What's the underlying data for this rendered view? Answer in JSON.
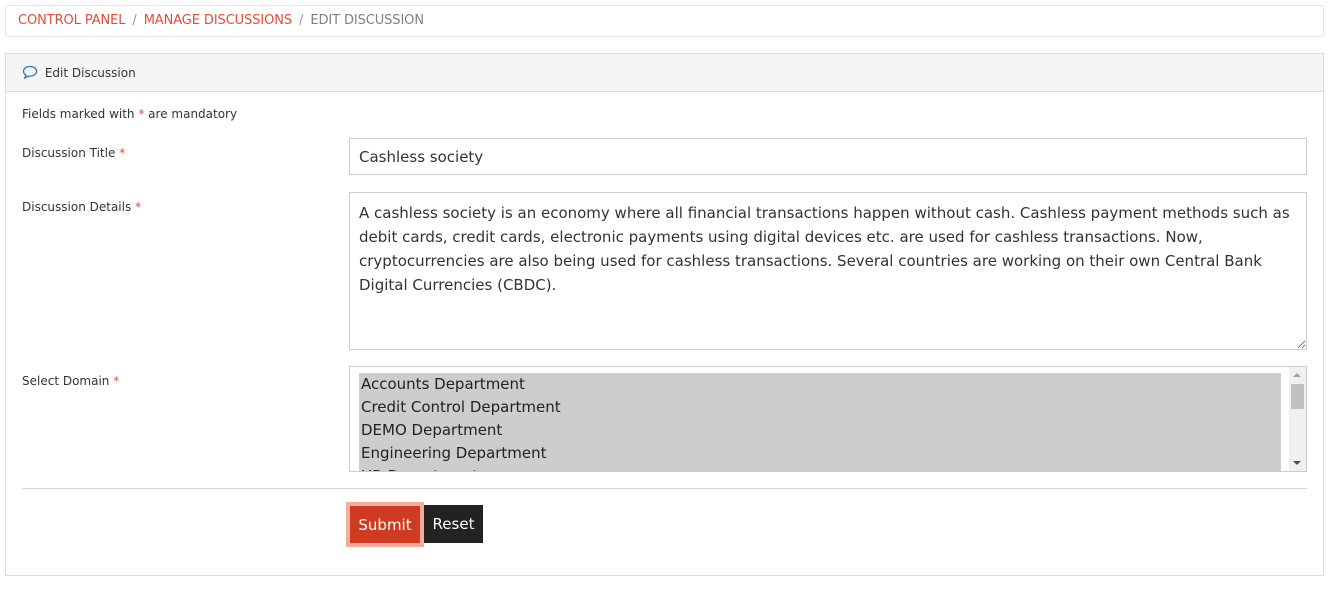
{
  "breadcrumb": {
    "items": [
      {
        "label": "CONTROL PANEL"
      },
      {
        "label": "MANAGE DISCUSSIONS"
      },
      {
        "label": "EDIT DISCUSSION"
      }
    ],
    "separator": "/"
  },
  "panel": {
    "title": "Edit Discussion",
    "icon": "speech-bubble-icon"
  },
  "form": {
    "note_prefix": "Fields marked with ",
    "required_marker": "*",
    "note_suffix": " are mandatory",
    "title_label": "Discussion Title",
    "title_value": "Cashless society",
    "details_label": "Discussion Details",
    "details_value": "A cashless society is an economy where all financial transactions happen without cash. Cashless payment methods such as debit cards, credit cards, electronic payments using digital devices etc. are used for cashless transactions. Now, cryptocurrencies are also being used for cashless transactions. Several countries are working on their own Central Bank Digital Currencies (CBDC).",
    "domain_label": "Select Domain",
    "domain_options": [
      {
        "label": "Accounts Department"
      },
      {
        "label": "Credit Control Department"
      },
      {
        "label": "DEMO Department"
      },
      {
        "label": "Engineering Department"
      },
      {
        "label": "HR Department"
      }
    ],
    "submit_label": "Submit",
    "reset_label": "Reset"
  },
  "colors": {
    "accent": "#cf3b21",
    "link": "#e14d3a",
    "reset_bg": "#222222",
    "selected_option_bg": "#cdcdcd"
  }
}
